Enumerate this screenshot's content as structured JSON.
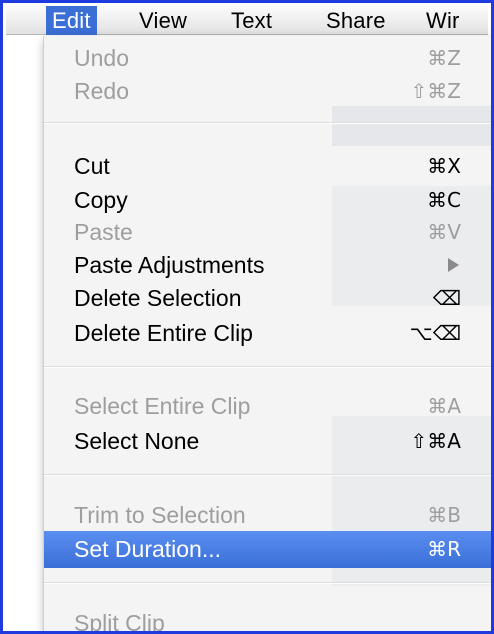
{
  "menubar": {
    "items": [
      {
        "label": "Edit",
        "active": true
      },
      {
        "label": "View",
        "active": false
      },
      {
        "label": "Text",
        "active": false
      },
      {
        "label": "Share",
        "active": false
      },
      {
        "label": "Wir",
        "active": false
      }
    ]
  },
  "menu": {
    "undo": {
      "label": "Undo",
      "shortcut": "⌘Z",
      "enabled": false
    },
    "redo": {
      "label": "Redo",
      "shortcut": "⇧⌘Z",
      "enabled": false
    },
    "cut": {
      "label": "Cut",
      "shortcut": "⌘X",
      "enabled": true
    },
    "copy": {
      "label": "Copy",
      "shortcut": "⌘C",
      "enabled": true
    },
    "paste": {
      "label": "Paste",
      "shortcut": "⌘V",
      "enabled": false
    },
    "paste_adj": {
      "label": "Paste Adjustments",
      "shortcut": "",
      "enabled": true,
      "submenu": true
    },
    "delete_sel": {
      "label": "Delete Selection",
      "shortcut": "⌫",
      "enabled": true
    },
    "delete_clip": {
      "label": "Delete Entire Clip",
      "shortcut": "⌥⌫",
      "enabled": true
    },
    "select_entire": {
      "label": "Select Entire Clip",
      "shortcut": "⌘A",
      "enabled": false
    },
    "select_none": {
      "label": "Select None",
      "shortcut": "⇧⌘A",
      "enabled": true
    },
    "trim": {
      "label": "Trim to Selection",
      "shortcut": "⌘B",
      "enabled": false
    },
    "set_duration": {
      "label": "Set Duration...",
      "shortcut": "⌘R",
      "enabled": true,
      "highlighted": true
    },
    "split_clip": {
      "label": "Split Clip",
      "shortcut": "",
      "enabled": false
    }
  },
  "colors": {
    "frame_border": "#1f3be0",
    "highlight": "#3a6fd8",
    "disabled_text": "#9e9e9e"
  }
}
